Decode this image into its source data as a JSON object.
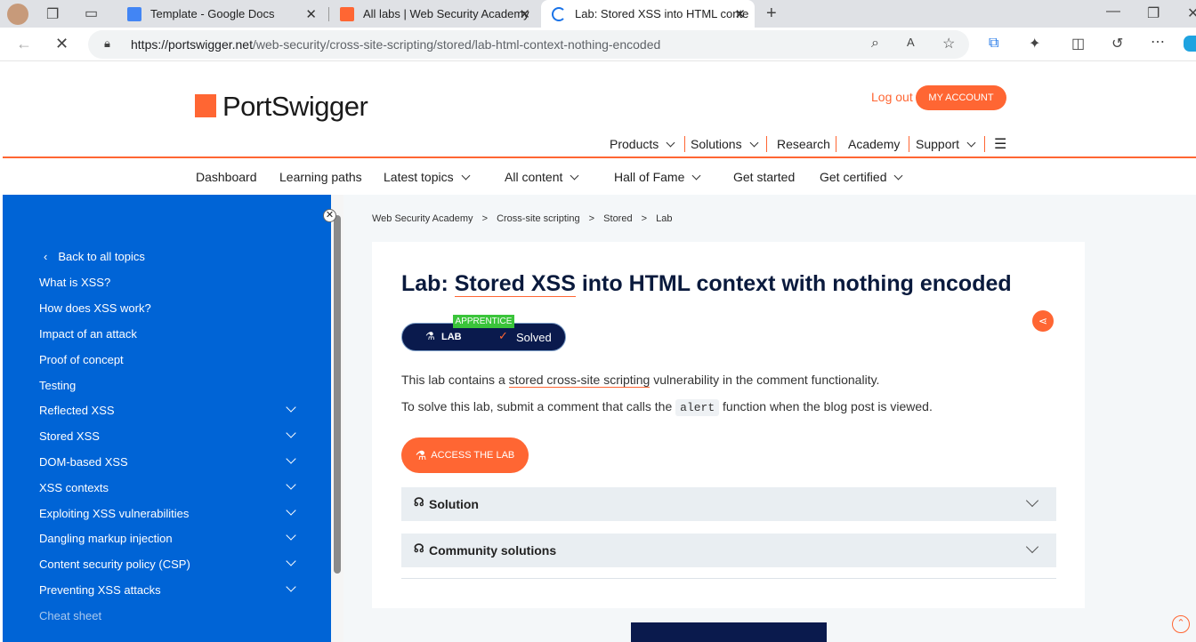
{
  "browser": {
    "tabs": [
      {
        "title": "Template - Google Docs",
        "icon_color": "#4285f4"
      },
      {
        "title": "All labs | Web Security Academy",
        "icon_color": "#ff6633"
      },
      {
        "title": "Lab: Stored XSS into HTML conte",
        "icon_color": "#1a73e8"
      }
    ],
    "new_tab": "+",
    "url_domain": "https://portswigger.net",
    "url_path": "/web-security/cross-site-scripting/stored/lab-html-context-nothing-encoded"
  },
  "header": {
    "logo": "PortSwigger",
    "logout": "Log out",
    "my_account": "MY ACCOUNT",
    "nav": {
      "products": "Products",
      "solutions": "Solutions",
      "research": "Research",
      "academy": "Academy",
      "support": "Support"
    }
  },
  "subnav": {
    "dashboard": "Dashboard",
    "learning_paths": "Learning paths",
    "latest_topics": "Latest topics",
    "all_content": "All content",
    "hall_of_fame": "Hall of Fame",
    "get_started": "Get started",
    "get_certified": "Get certified"
  },
  "sidebar": {
    "back": "Back to all topics",
    "items": [
      "What is XSS?",
      "How does XSS work?",
      "Impact of an attack",
      "Proof of concept",
      "Testing",
      "Reflected XSS",
      "Stored XSS",
      "DOM-based XSS",
      "XSS contexts",
      "Exploiting XSS vulnerabilities",
      "Dangling markup injection",
      "Content security policy (CSP)",
      "Preventing XSS attacks",
      "Cheat sheet"
    ]
  },
  "breadcrumb": [
    "Web Security Academy",
    "Cross-site scripting",
    "Stored",
    "Lab"
  ],
  "lab": {
    "title_prefix": "Lab: ",
    "title_link": "Stored XSS",
    "title_rest": " into HTML context with nothing encoded",
    "level": "APPRENTICE",
    "badge_lab": "LAB",
    "status": "Solved",
    "para1_a": "This lab contains a ",
    "para1_link": "stored cross-site scripting",
    "para1_b": " vulnerability in the comment functionality.",
    "para2_a": "To solve this lab, submit a comment that calls the ",
    "para2_code": "alert",
    "para2_b": " function when the blog post is viewed.",
    "access_button": "ACCESS THE LAB",
    "solution": "Solution",
    "community": "Community solutions"
  }
}
